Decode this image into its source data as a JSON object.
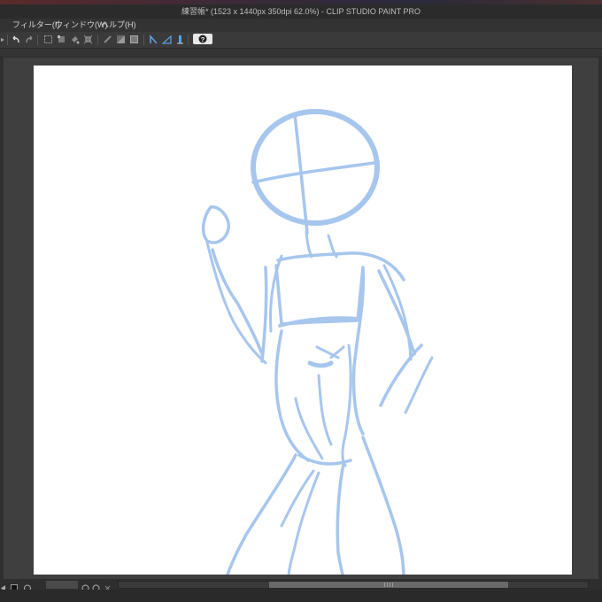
{
  "window": {
    "title": "練習帳* (1523 x 1440px 350dpi 62.0%)  - CLIP STUDIO PAINT PRO"
  },
  "menu": {
    "items": [
      {
        "label": "フィルター(I)"
      },
      {
        "label": "ウィンドウ(W)"
      },
      {
        "label": "ヘルプ(H)"
      }
    ]
  },
  "toolbar": {
    "help_label": "?",
    "icons": [
      "undo-icon",
      "redo-icon",
      "select-all-icon",
      "transform-icon",
      "fill-icon",
      "scale-icon",
      "clear-icon",
      "invert-icon",
      "ruler-icon",
      "snap-ruler-icon",
      "snap-grid-icon",
      "snap-special-icon"
    ]
  },
  "colors": {
    "sketch_stroke": "#a7c6ee",
    "canvas": "#ffffff",
    "workspace": "#3f3f3f"
  }
}
